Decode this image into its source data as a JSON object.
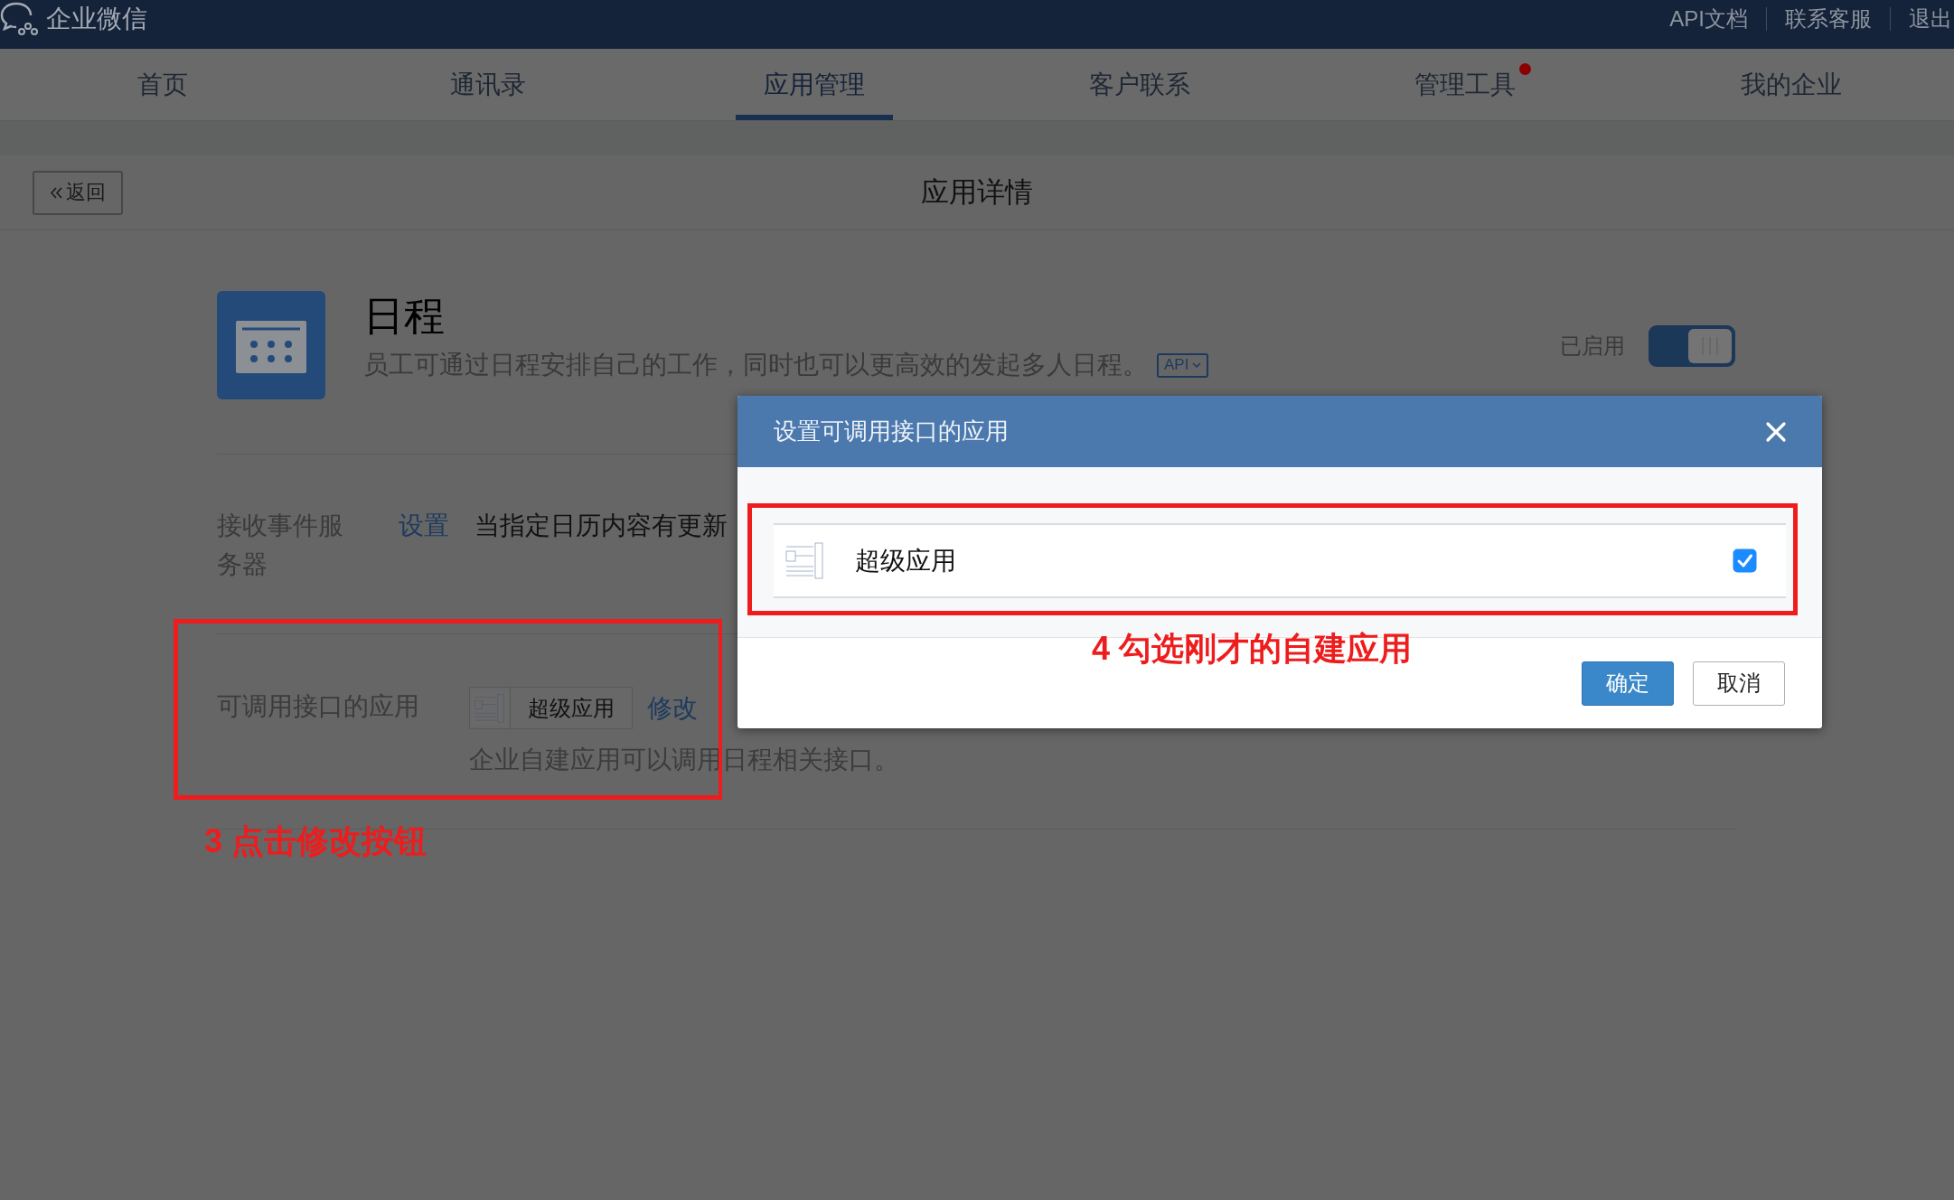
{
  "top_bar": {
    "logo_text": "企业微信",
    "links": [
      "API文档",
      "联系客服",
      "退出"
    ]
  },
  "nav": {
    "tabs": [
      {
        "label": "首页",
        "selected": false,
        "notification_dot": false
      },
      {
        "label": "通讯录",
        "selected": false,
        "notification_dot": false
      },
      {
        "label": "应用管理",
        "selected": true,
        "notification_dot": false
      },
      {
        "label": "客户联系",
        "selected": false,
        "notification_dot": false
      },
      {
        "label": "管理工具",
        "selected": false,
        "notification_dot": true
      },
      {
        "label": "我的企业",
        "selected": false,
        "notification_dot": false
      }
    ]
  },
  "page_header": {
    "back_button": "返回",
    "title": "应用详情"
  },
  "app": {
    "name": "日程",
    "description": "员工可通过日程安排自己的工作，同时也可以更高效的发起多人日程。",
    "api_badge": "API",
    "status_label": "已启用",
    "enabled": true
  },
  "settings": [
    {
      "kind": "event_server",
      "label": "接收事件服务器",
      "link": "设置",
      "text": "当指定日历内容有更新"
    },
    {
      "kind": "api_apps",
      "label": "可调用接口的应用",
      "chips": [
        {
          "name": "超级应用"
        }
      ],
      "link": "修改",
      "note": "企业自建应用可以调用日程相关接口。"
    }
  ],
  "dialog": {
    "title": "设置可调用接口的应用",
    "apps": [
      {
        "name": "超级应用",
        "checked": true
      }
    ],
    "buttons": [
      {
        "label": "确定",
        "kind": "primary"
      },
      {
        "label": "取消",
        "kind": "secondary"
      }
    ]
  },
  "annotations": [
    {
      "text": "3 点击修改按钮"
    },
    {
      "text": "4 勾选刚才的自建应用"
    }
  ]
}
